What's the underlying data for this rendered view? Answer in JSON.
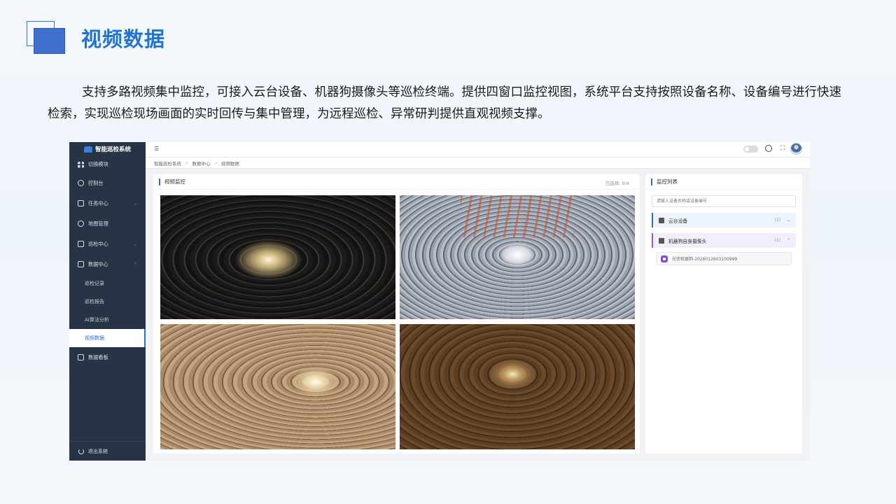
{
  "slide": {
    "title": "视频数据",
    "description": "支持多路视频集中监控，可接入云台设备、机器狗摄像头等巡检终端。提供四窗口监控视图，系统平台支持按照设备名称、设备编号进行快速检索，实现巡检现场画面的实时回传与集中管理，为远程巡检、异常研判提供直观视频支撑。"
  },
  "app": {
    "brand": "智能巡检系统",
    "sidebar": {
      "items": [
        {
          "label": "切换模块",
          "icon": "grid-icon"
        },
        {
          "label": "控制台",
          "icon": "dashboard-icon"
        },
        {
          "label": "任务中心",
          "icon": "calendar-icon",
          "caret": "⌄"
        },
        {
          "label": "地图管理",
          "icon": "map-icon"
        },
        {
          "label": "巡检中心",
          "icon": "list-icon",
          "caret": "⌄"
        },
        {
          "label": "数据中心",
          "icon": "chart-icon",
          "caret": "⌃"
        }
      ],
      "sub_items": [
        "巡检记录",
        "巡检报告",
        "AI算法分析",
        "视频数据"
      ],
      "after_items": [
        {
          "label": "数据看板",
          "icon": "monitor-icon"
        }
      ],
      "logout": "退出系统"
    },
    "topbar": {
      "menu_icon": "☰",
      "fullscreen_icon": "⛶"
    },
    "breadcrumb": [
      "智能巡检系统",
      "数据中心",
      "视频数据"
    ],
    "breadcrumb_sep": ">",
    "video_panel": {
      "title": "视频监控",
      "selected": "已选择: 0/4"
    },
    "monitor_list": {
      "title": "监控列表",
      "search_placeholder": "请输入设备名称或设备编号",
      "groups": [
        {
          "label": "云台设备",
          "count": "(1)",
          "caret": "⌄"
        },
        {
          "label": "机器狗自身摄像头",
          "count": "(1)",
          "caret": "⌃"
        }
      ],
      "devices": [
        "光伏机器狗-2026012603100999"
      ]
    }
  },
  "colors": {
    "title": "#1f74d4",
    "accent": "#2a6dd1",
    "sidebar": "#263445",
    "purple": "#8a5cd6"
  }
}
